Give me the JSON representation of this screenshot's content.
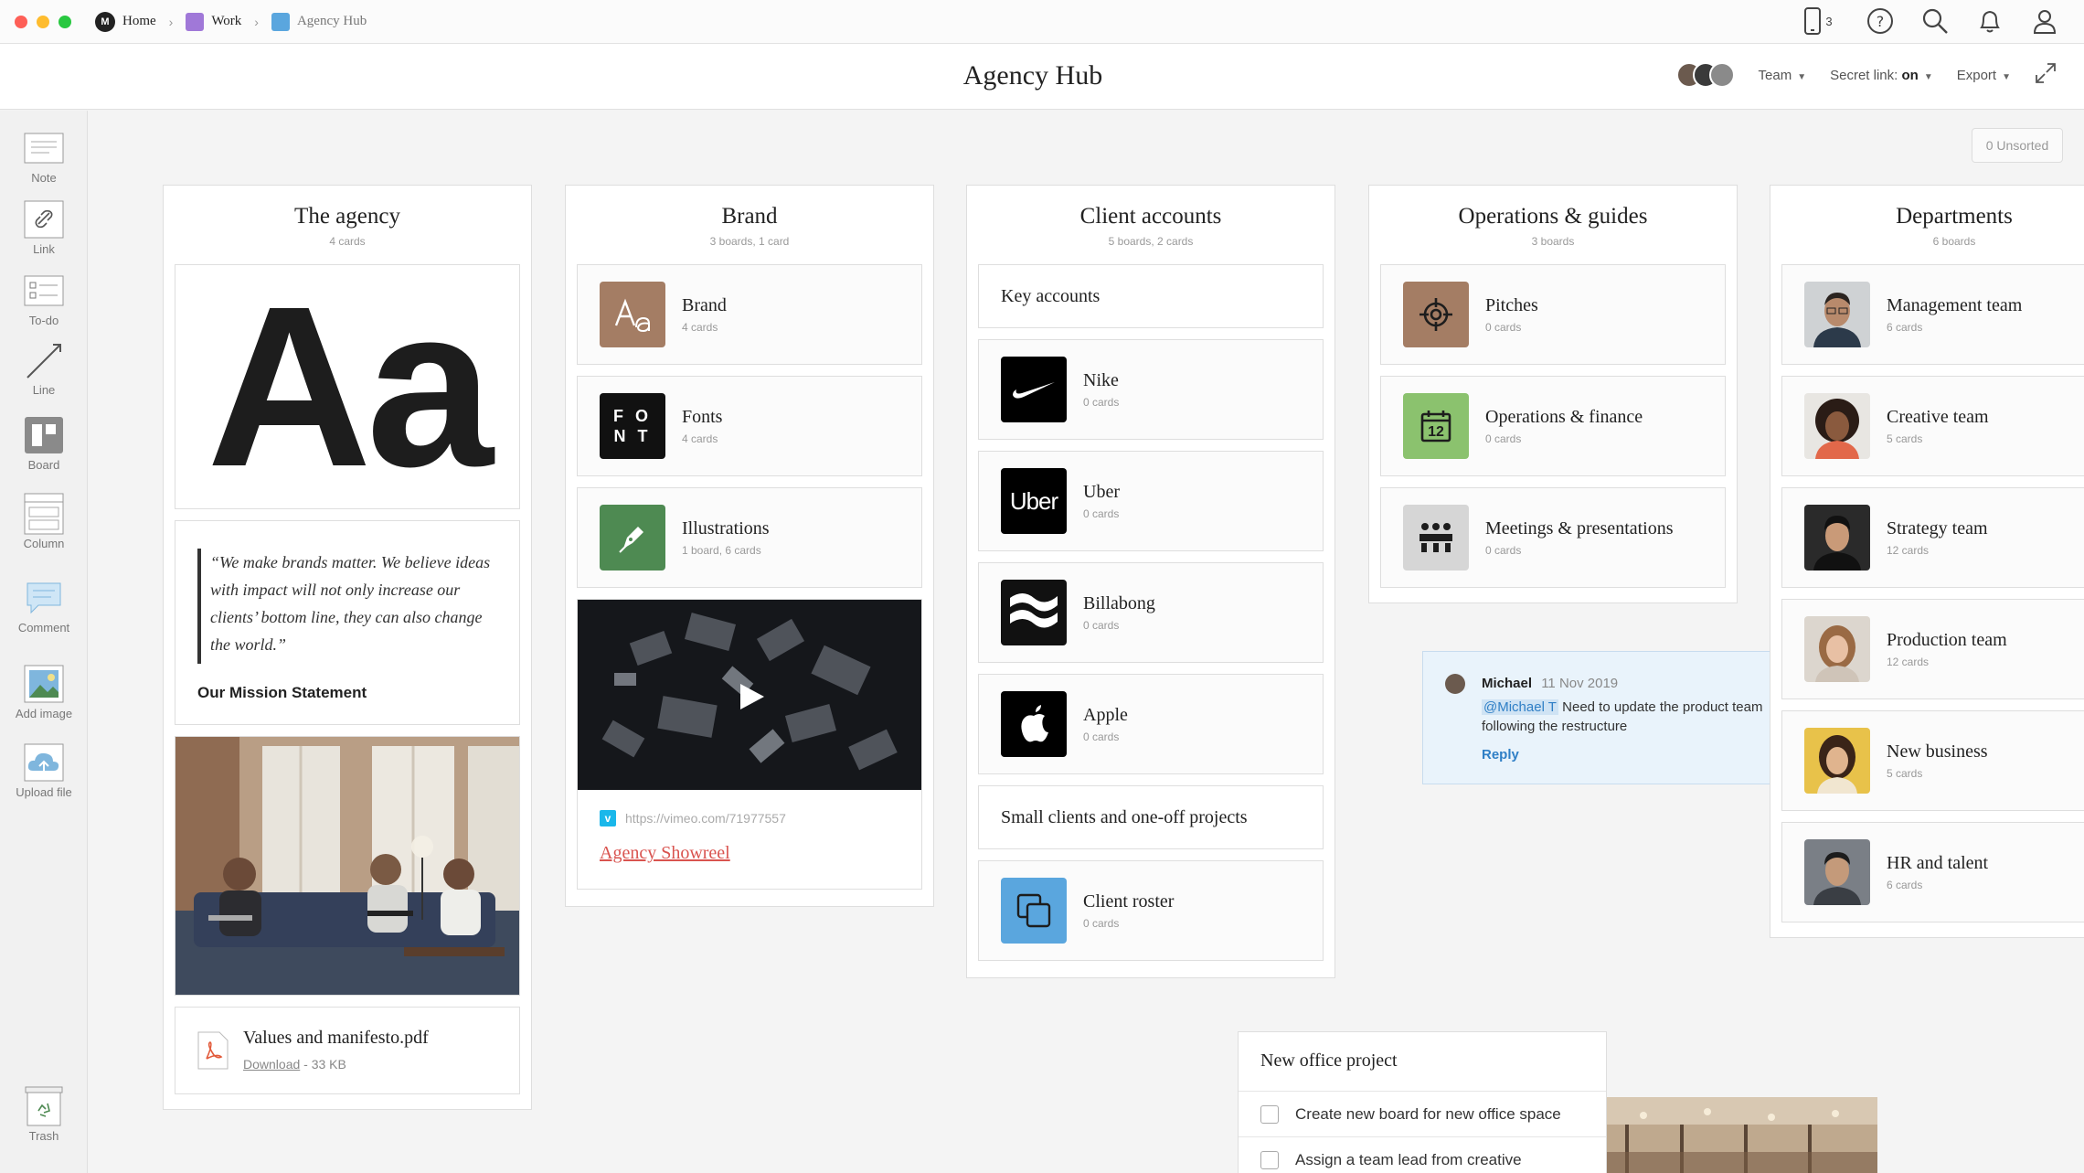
{
  "breadcrumbs": {
    "home": "Home",
    "work": "Work",
    "current": "Agency Hub"
  },
  "topbar": {
    "device_count": "3"
  },
  "board": {
    "title": "Agency Hub",
    "team_label": "Team",
    "secret_link_label": "Secret link:",
    "secret_link_value": "on",
    "export_label": "Export",
    "unsorted": "0 Unsorted"
  },
  "tools": {
    "note": "Note",
    "link": "Link",
    "todo": "To-do",
    "line": "Line",
    "board": "Board",
    "column": "Column",
    "comment": "Comment",
    "add_image": "Add image",
    "upload_file": "Upload file",
    "trash": "Trash"
  },
  "agency": {
    "title": "The agency",
    "sub": "4 cards",
    "font_sample": "Aa",
    "quote": "“We make brands matter. We believe ideas with impact will not only increase our clients’ bottom line, they can also change the world.”",
    "quote_caption": "Our Mission Statement",
    "file_name": "Values and manifesto.pdf",
    "file_link": "Download",
    "file_size": " - 33 KB"
  },
  "brand": {
    "title": "Brand",
    "sub": "3 boards, 1 card",
    "items": [
      {
        "name": "Brand",
        "sub": "4 cards"
      },
      {
        "name": "Fonts",
        "sub": "4 cards"
      },
      {
        "name": "Illustrations",
        "sub": "1 board, 6 cards"
      }
    ],
    "video_url": "https://vimeo.com/71977557",
    "video_title": "Agency Showreel",
    "fonts_glyph_1": "F O",
    "fonts_glyph_2": "N T"
  },
  "clients": {
    "title": "Client accounts",
    "sub": "5 boards, 2 cards",
    "key_accounts": "Key accounts",
    "items": [
      {
        "name": "Nike",
        "sub": "0 cards"
      },
      {
        "name": "Uber",
        "sub": "0 cards"
      },
      {
        "name": "Billabong",
        "sub": "0 cards"
      },
      {
        "name": "Apple",
        "sub": "0 cards"
      }
    ],
    "uber_logo": "Uber",
    "small_clients": "Small clients and one-off projects",
    "roster": {
      "name": "Client roster",
      "sub": "0 cards"
    }
  },
  "operations": {
    "title": "Operations & guides",
    "sub": "3 boards",
    "items": [
      {
        "name": "Pitches",
        "sub": "0 cards"
      },
      {
        "name": "Operations & finance",
        "sub": "0 cards"
      },
      {
        "name": "Meetings & presentations",
        "sub": "0 cards"
      }
    ],
    "calendar_day": "12"
  },
  "departments": {
    "title": "Departments",
    "sub": "6 boards",
    "items": [
      {
        "name": "Management team",
        "sub": "6 cards"
      },
      {
        "name": "Creative team",
        "sub": "5 cards"
      },
      {
        "name": "Strategy team",
        "sub": "12 cards"
      },
      {
        "name": "Production team",
        "sub": "12 cards"
      },
      {
        "name": "New business",
        "sub": "5 cards"
      },
      {
        "name": "HR and talent",
        "sub": "6 cards"
      }
    ]
  },
  "comment": {
    "author": "Michael",
    "date": "11 Nov 2019",
    "mention": "@Michael T",
    "text": " Need to update the product team following the restructure",
    "reply": "Reply"
  },
  "todo": {
    "title": "New office project",
    "items": [
      "Create new board for new office space",
      "Assign a team lead from creative"
    ]
  },
  "colors": {
    "accent_link": "#d9534f",
    "comment_blue": "#2f7fc6",
    "brand_tan": "#a47d64",
    "illus_green": "#4e8a52",
    "ops_green": "#8bc26e",
    "roster_blue": "#5aa6de"
  }
}
